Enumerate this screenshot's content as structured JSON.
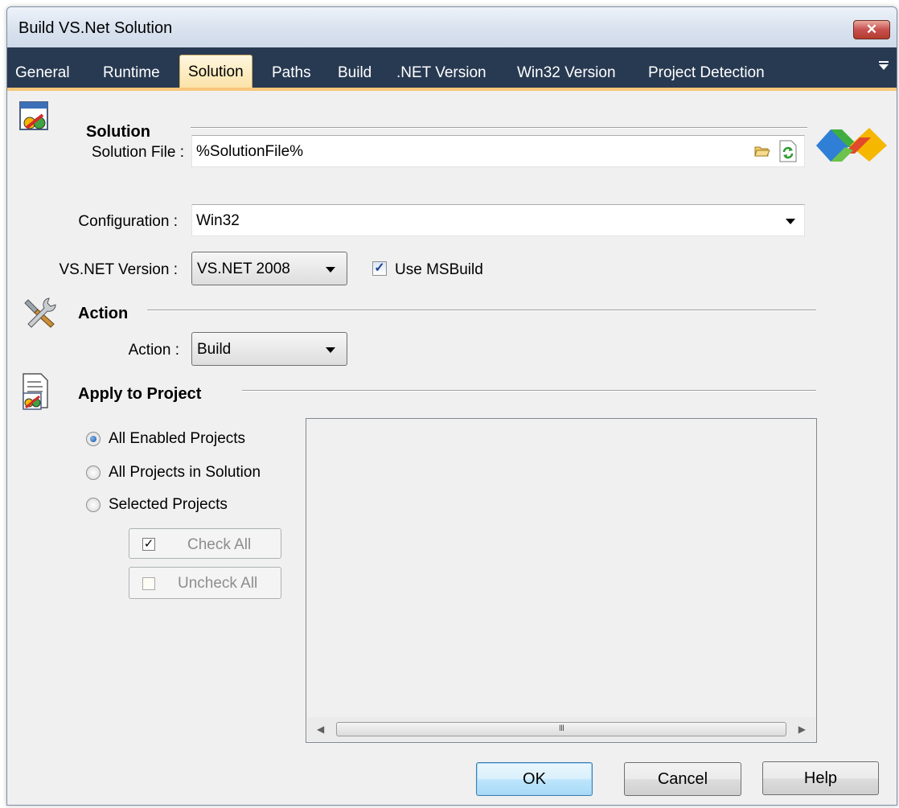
{
  "window": {
    "title": "Build VS.Net Solution",
    "close_symbol": "✕"
  },
  "tabs": [
    "General",
    "Runtime",
    "Solution",
    "Paths",
    "Build",
    ".NET Version",
    "Win32 Version",
    "Project Detection"
  ],
  "active_tab": "Solution",
  "solution_section": {
    "title": "Solution",
    "solution_file_label": "Solution File :",
    "solution_file_value": "%SolutionFile%",
    "configuration_label": "Configuration :",
    "configuration_value": "Win32",
    "vsnet_version_label": "VS.NET Version :",
    "vsnet_version_value": "VS.NET 2008",
    "use_msbuild_label": "Use MSBuild",
    "use_msbuild_checked": true
  },
  "action_section": {
    "title": "Action",
    "action_label": "Action :",
    "action_value": "Build"
  },
  "apply_section": {
    "title": "Apply to Project",
    "options": [
      "All Enabled Projects",
      "All Projects in Solution",
      "Selected Projects"
    ],
    "selected_option": "All Enabled Projects",
    "check_all_label": "Check All",
    "uncheck_all_label": "Uncheck All",
    "scrollbar_grip": "III"
  },
  "buttons": {
    "ok": "OK",
    "cancel": "Cancel",
    "help": "Help"
  },
  "colors": {
    "tab_bar": "#283a52",
    "tab_accent": "#f7c77a",
    "window_bg": "#f0f0f0"
  }
}
